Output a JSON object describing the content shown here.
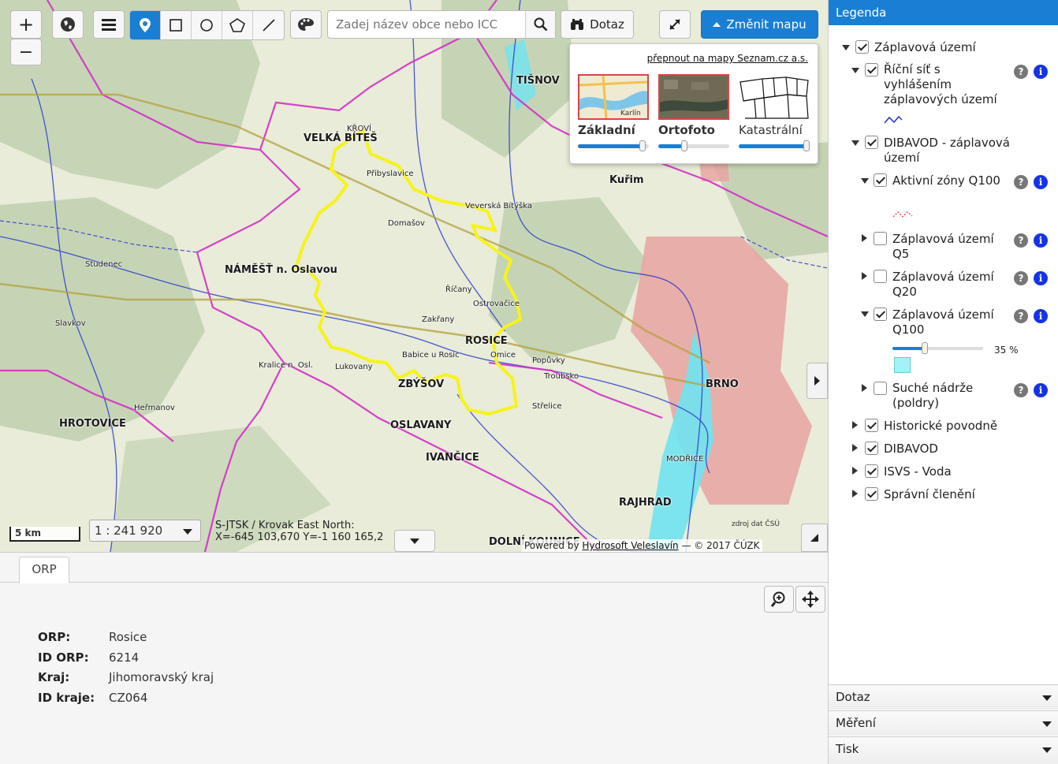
{
  "map": {
    "zoom_in": "+",
    "zoom_out": "−",
    "search_placeholder": "Zadej název obce nebo ICC",
    "query_button": "Dotaz",
    "change_map_button": "Změnit mapu",
    "basemap_switch_link": "přepnout na mapy Seznam.cz a.s.",
    "basemaps": [
      {
        "label": "Základní",
        "level": 0.95,
        "selected": true
      },
      {
        "label": "Ortofoto",
        "level": 0.35,
        "selected": true
      },
      {
        "label": "Katastrální",
        "level": 1.0,
        "selected": false
      }
    ],
    "scale_bar": "5 km",
    "scale_value": "1 : 241 920",
    "coord_line1": "S-JTSK / Krovak East North:",
    "coord_line2": "X=-645 103,670 Y=-1 160 165,2",
    "attribution_prefix": "Powered by",
    "attribution_link": "Hydrosoft Veleslavín",
    "attribution_suffix": "— © 2017 ČÚZK",
    "map_corner_credit": "zdroj dat ČSÚ",
    "place_labels": [
      "TIŠNOV",
      "VELKÁ BÍTEŠ",
      "KŘOVÍ",
      "NÁMĚŠŤ n. Oslavou",
      "ROSICE",
      "ZBÝŠOV",
      "BRNO",
      "IVANČICE",
      "OSLAVANY",
      "HROTOVICE",
      "DOLNÍ KOUNICE",
      "RAJHRAD",
      "MODŘICE",
      "Říčany",
      "Veverská Bítýška",
      "Troubsko",
      "Domašov",
      "Zakřany",
      "Babice u Rosic",
      "Lukovany",
      "Přibyslavice",
      "Omice",
      "Popůvky",
      "Střelice",
      "Ostrovačice",
      "Kuřim",
      "Kralice n. Osl.",
      "Slavkov",
      "Studenec",
      "Heřmanov"
    ],
    "colors": {
      "accent": "#1a7fd4",
      "orp_boundary": "#f7f31a",
      "district_boundary": "#d42fc6",
      "flood_zone": "#6fe3f0",
      "urban": "#e79a98"
    }
  },
  "bottom": {
    "tab": "ORP",
    "fields": [
      {
        "key": "ORP",
        "value": "Rosice"
      },
      {
        "key": "ID ORP",
        "value": "6214"
      },
      {
        "key": "Kraj",
        "value": "Jihomoravský kraj"
      },
      {
        "key": "ID kraje",
        "value": "CZ064"
      }
    ]
  },
  "legend": {
    "title": "Legenda",
    "items": {
      "zaplavova_uzemi": "Záplavová území",
      "ricni_sit": "Říční síť s vyhlášením záplavových území",
      "dibavod_zaplavova": "DIBAVOD - záplavová území",
      "aktivni_zony": "Aktivní zóny Q100",
      "q5": "Záplavová území Q5",
      "q20": "Záplavová území Q20",
      "q100": "Záplavová území Q100",
      "q100_opacity": "35 %",
      "q100_opacity_value": 0.35,
      "suche_nadrze": "Suché nádrže (poldry)",
      "historicke": "Historické povodně",
      "dibavod": "DIBAVOD",
      "isvs": "ISVS - Voda",
      "spravni": "Správní členění"
    },
    "help_icon": "?",
    "info_icon": "i"
  },
  "accordions": [
    "Dotaz",
    "Měření",
    "Tisk"
  ]
}
